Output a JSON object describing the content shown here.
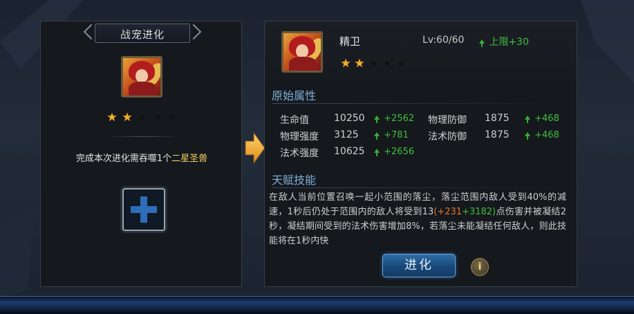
{
  "left_panel": {
    "title": "战宠进化",
    "star_count": 2,
    "max_stars": 5,
    "requirement_prefix": "完成本次进化需吞噬1个",
    "requirement_highlight": "二星圣兽"
  },
  "right_panel": {
    "pet_name": "精卫",
    "level": "Lv:60/60",
    "level_cap_bonus": "上限+30",
    "star_count": 2,
    "max_stars": 5,
    "base_attributes_title": "原始属性",
    "stats": [
      {
        "label": "生命值",
        "value": "10250",
        "increase": "+2562"
      },
      {
        "label": "物理防御",
        "value": "1875",
        "increase": "+468"
      },
      {
        "label": "物理强度",
        "value": "3125",
        "increase": "+781"
      },
      {
        "label": "法术防御",
        "value": "1875",
        "increase": "+468"
      },
      {
        "label": "法术强度",
        "value": "10625",
        "increase": "+2656"
      }
    ],
    "talent_title": "天赋技能",
    "talent_desc_part1": "在敌人当前位置召唤一起小范围的落尘，落尘范围内敌人受到40%的减速，1秒后仍处于范围内的敌人将受到13",
    "talent_desc_dmg": "(+231",
    "talent_desc_plus": "+3182)",
    "talent_desc_part2": "点伤害并被凝结2秒，凝结期间受到的法术伤害增加8%，若落尘未能凝结任何敌人，则此技能将在1秒内快",
    "evolve_button": "进化",
    "info_button": "i"
  },
  "colors": {
    "accent_blue": "#7fb0d8",
    "increase_green": "#3ec03e",
    "star_gold": "#f0b12a",
    "highlight_yellow": "#f2d060",
    "damage_orange": "#e07a2a"
  }
}
